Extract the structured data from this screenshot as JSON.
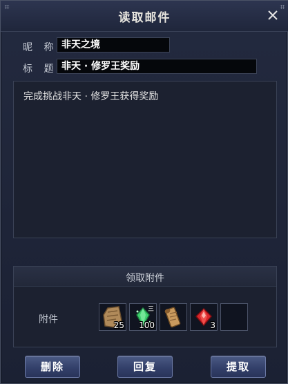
{
  "window": {
    "title": "读取邮件",
    "corner_left_icon": "ornament-icon",
    "corner_right_icon": "ornament-icon",
    "close_icon": "close-icon"
  },
  "header": {
    "nickname_label": "昵 称",
    "nickname_value": "非天之境",
    "subject_label": "标 题",
    "subject_value": "非天 · 修罗王奖励"
  },
  "body": {
    "text": "完成挑战非天 · 修罗王获得奖励"
  },
  "attachments": {
    "header": "领取附件",
    "label": "附件",
    "items": [
      {
        "icon": "scroll-item-icon",
        "quantity": "25"
      },
      {
        "icon": "green-gem-icon",
        "quantity": "100",
        "tier": "三"
      },
      {
        "icon": "rolled-scroll-icon",
        "quantity": ""
      },
      {
        "icon": "red-gem-icon",
        "quantity": "3"
      },
      {
        "icon": "empty-slot",
        "quantity": ""
      }
    ]
  },
  "buttons": {
    "delete": "删除",
    "reply": "回复",
    "claim": "提取"
  },
  "colors": {
    "window_bg": "#1e2438",
    "field_bg": "#05070b",
    "button_bg": "#33406a",
    "text": "#c7cdd8"
  }
}
